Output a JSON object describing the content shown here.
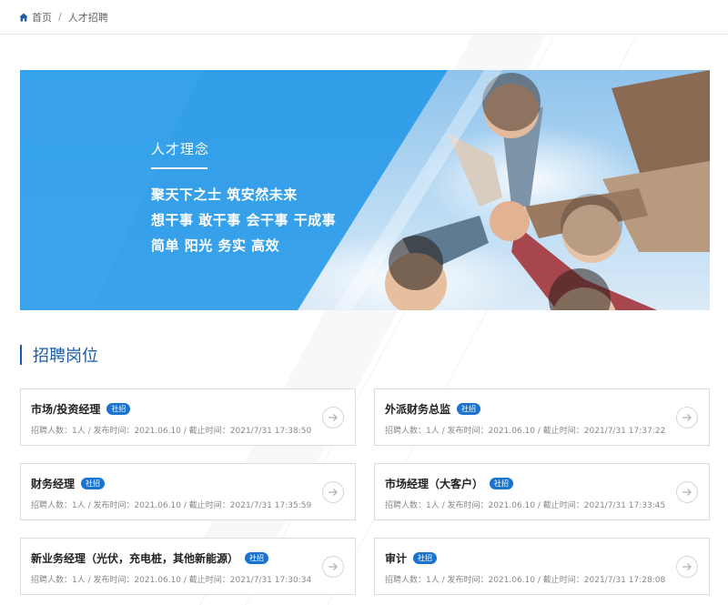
{
  "breadcrumb": {
    "home_label": "首页",
    "separator": "/",
    "current_label": "人才招聘"
  },
  "banner": {
    "title": "人才理念",
    "lines": [
      "聚天下之士 筑安然未来",
      "想干事 敢干事 会干事 干成事",
      "简单 阳光 务实 高效"
    ]
  },
  "section": {
    "title": "招聘岗位"
  },
  "jobs": [
    {
      "title": "市场/投资经理",
      "tag": "社招",
      "meta": "招聘人数：1人 / 发布时间：2021.06.10 / 截止时间：2021/7/31 17:38:50"
    },
    {
      "title": "外派财务总监",
      "tag": "社招",
      "meta": "招聘人数：1人 / 发布时间：2021.06.10 / 截止时间：2021/7/31 17:37:22"
    },
    {
      "title": "财务经理",
      "tag": "社招",
      "meta": "招聘人数：1人 / 发布时间：2021.06.10 / 截止时间：2021/7/31 17:35:59"
    },
    {
      "title": "市场经理（大客户）",
      "tag": "社招",
      "meta": "招聘人数：1人 / 发布时间：2021.06.10 / 截止时间：2021/7/31 17:33:45"
    },
    {
      "title": "新业务经理（光伏，充电桩，其他新能源）",
      "tag": "社招",
      "meta": "招聘人数：1人 / 发布时间：2021.06.10 / 截止时间：2021/7/31 17:30:34"
    },
    {
      "title": "审计",
      "tag": "社招",
      "meta": "招聘人数：1人 / 发布时间：2021.06.10 / 截止时间：2021/7/31 17:28:08"
    }
  ],
  "colors": {
    "accent": "#1a5ca8",
    "tag_bg": "#1b73d0",
    "banner_blue": "#2a9be8"
  },
  "icons": {
    "home": "home-icon",
    "arrow": "arrow-right-circle-icon"
  }
}
